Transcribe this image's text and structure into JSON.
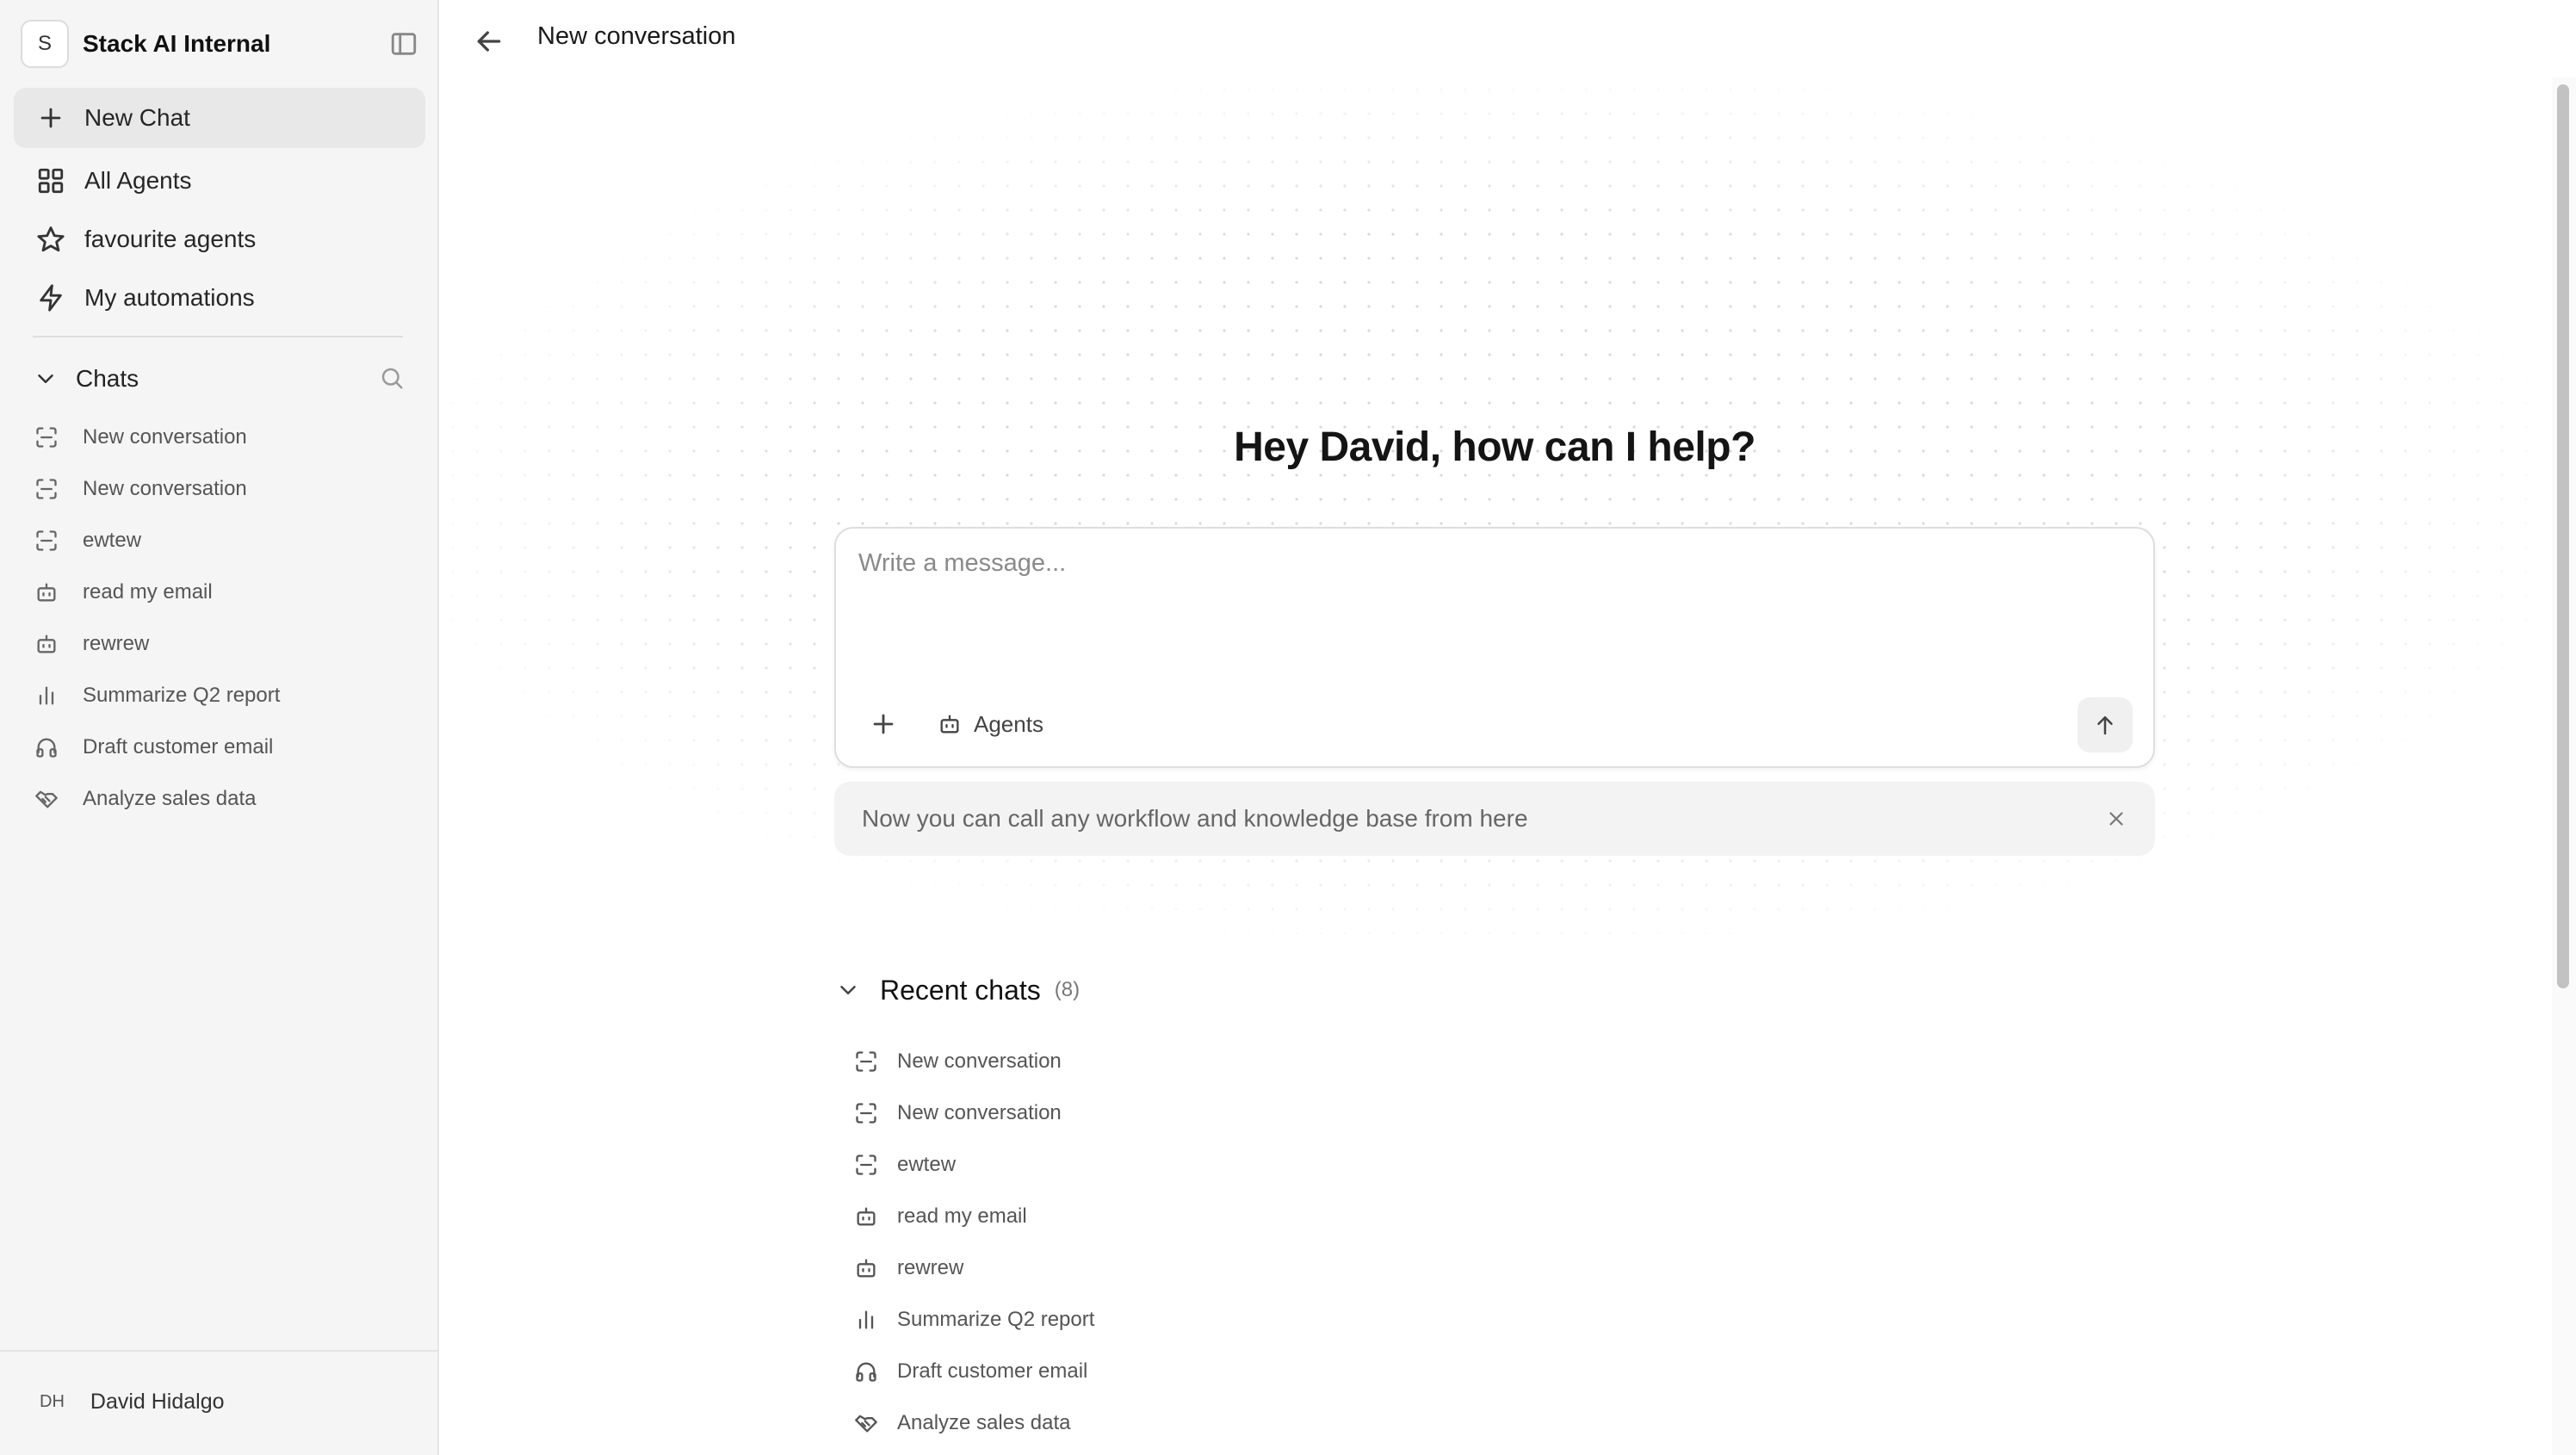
{
  "workspace": {
    "avatar_letter": "S",
    "name": "Stack AI Internal"
  },
  "sidebar": {
    "nav": [
      {
        "label": "New Chat",
        "icon": "plus-icon"
      },
      {
        "label": "All Agents",
        "icon": "grid-icon"
      },
      {
        "label": "favourite agents",
        "icon": "star-icon"
      },
      {
        "label": "My automations",
        "icon": "lightning-icon"
      }
    ],
    "chats_label": "Chats",
    "chats": [
      {
        "label": "New conversation",
        "icon": "chat-frame-icon"
      },
      {
        "label": "New conversation",
        "icon": "chat-frame-icon"
      },
      {
        "label": "ewtew",
        "icon": "chat-frame-icon"
      },
      {
        "label": "read my email",
        "icon": "robot-icon"
      },
      {
        "label": "rewrew",
        "icon": "robot-icon"
      },
      {
        "label": "Summarize Q2 report",
        "icon": "bar-chart-icon"
      },
      {
        "label": "Draft customer email",
        "icon": "headphones-icon"
      },
      {
        "label": "Analyze sales data",
        "icon": "handshake-icon"
      }
    ],
    "user": {
      "initials": "DH",
      "name": "David Hidalgo"
    }
  },
  "header": {
    "title": "New conversation"
  },
  "main": {
    "greeting": "Hey David, how can I help?",
    "composer": {
      "placeholder": "Write a message...",
      "value": "",
      "agents_label": "Agents"
    },
    "notice": "Now you can call any workflow and knowledge base from here",
    "recent": {
      "title": "Recent chats",
      "count": "(8)",
      "items": [
        {
          "label": "New conversation",
          "icon": "chat-frame-icon"
        },
        {
          "label": "New conversation",
          "icon": "chat-frame-icon"
        },
        {
          "label": "ewtew",
          "icon": "chat-frame-icon"
        },
        {
          "label": "read my email",
          "icon": "robot-icon"
        },
        {
          "label": "rewrew",
          "icon": "robot-icon"
        },
        {
          "label": "Summarize Q2 report",
          "icon": "bar-chart-icon"
        },
        {
          "label": "Draft customer email",
          "icon": "headphones-icon"
        },
        {
          "label": "Analyze sales data",
          "icon": "handshake-icon"
        }
      ]
    }
  },
  "colors": {
    "sidebar_bg": "#f5f5f5",
    "active_item_bg": "#e8e8e8",
    "notice_bg": "#f3f3f3",
    "text_primary": "#171717"
  }
}
